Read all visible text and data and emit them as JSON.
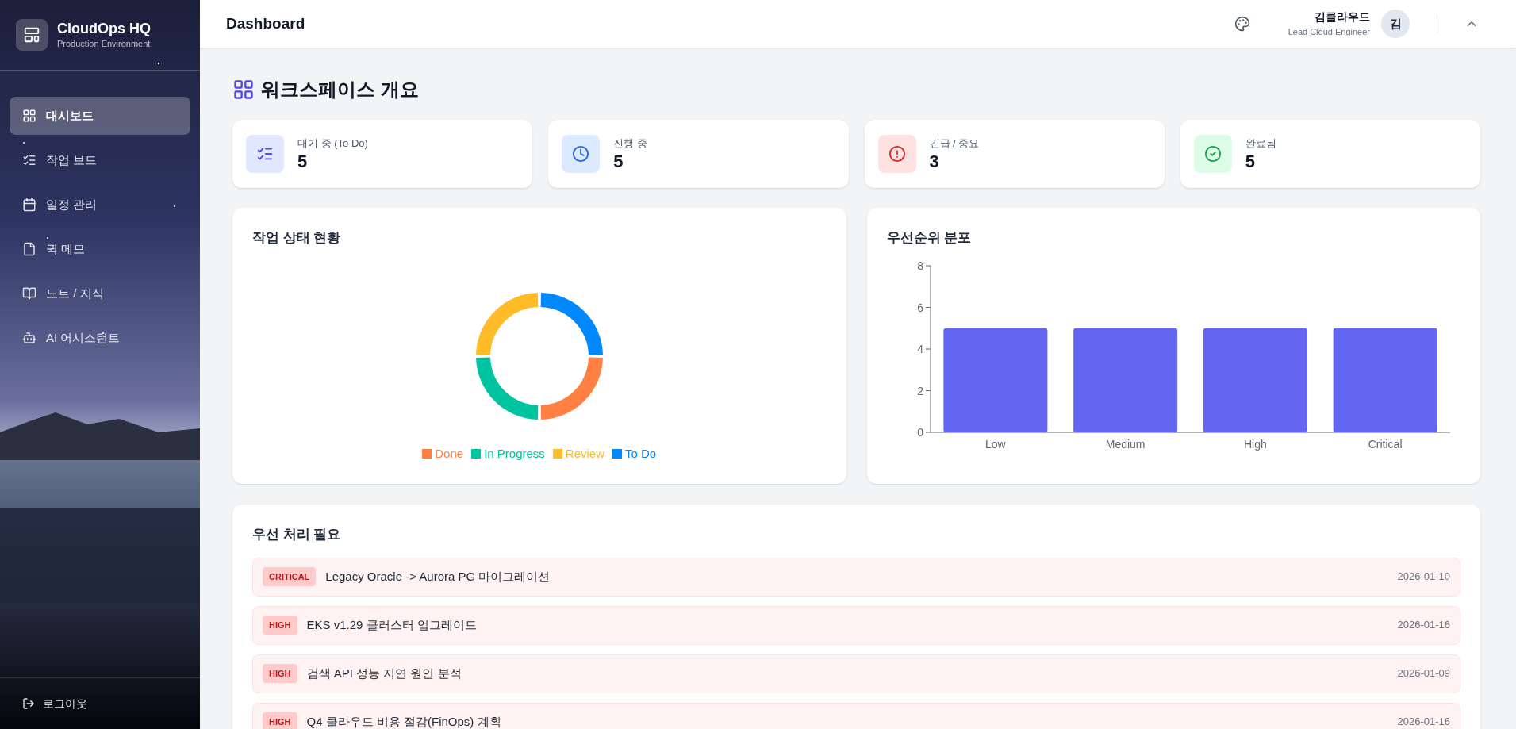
{
  "brand": {
    "name": "CloudOps HQ",
    "subtitle": "Production Environment"
  },
  "nav": [
    {
      "label": "대시보드",
      "selected": true
    },
    {
      "label": "작업 보드",
      "selected": false
    },
    {
      "label": "일정 관리",
      "selected": false
    },
    {
      "label": "퀵 메모",
      "selected": false
    },
    {
      "label": "노트 / 지식",
      "selected": false
    },
    {
      "label": "AI 어시스턴트",
      "selected": false
    }
  ],
  "logout": "로그아웃",
  "header": {
    "title": "Dashboard",
    "user_name": "김클라우드",
    "user_role": "Lead Cloud Engineer",
    "avatar": "김"
  },
  "page_title": "워크스페이스 개요",
  "stats": [
    {
      "label": "대기 중 (To Do)",
      "value": "5",
      "kind": "todo"
    },
    {
      "label": "진행 중",
      "value": "5",
      "kind": "progress"
    },
    {
      "label": "긴급 / 중요",
      "value": "3",
      "kind": "urgent"
    },
    {
      "label": "완료됨",
      "value": "5",
      "kind": "done"
    }
  ],
  "status_card": {
    "title": "작업 상태 현황",
    "chart_data": {
      "type": "donut",
      "categories": [
        "Done",
        "In Progress",
        "Review",
        "To Do"
      ],
      "values": [
        25,
        25,
        25,
        25
      ],
      "colors": [
        "#ff8042",
        "#00c49f",
        "#ffbb28",
        "#0088fe"
      ],
      "legend": "bottom"
    }
  },
  "priority_card": {
    "title": "우선순위 분포",
    "chart_data": {
      "type": "bar",
      "categories": [
        "Low",
        "Medium",
        "High",
        "Critical"
      ],
      "values": [
        5,
        5,
        5,
        5
      ],
      "color": "#6366f1",
      "ylim": [
        0,
        8
      ],
      "yticks": [
        0,
        2,
        4,
        6,
        8
      ]
    }
  },
  "urgent": {
    "title": "우선 처리 필요",
    "items": [
      {
        "badge": "CRITICAL",
        "title": "Legacy Oracle -> Aurora PG 마이그레이션",
        "date": "2026-01-10"
      },
      {
        "badge": "HIGH",
        "title": "EKS v1.29 클러스터 업그레이드",
        "date": "2026-01-16"
      },
      {
        "badge": "HIGH",
        "title": "검색 API 성능 지연 원인 분석",
        "date": "2026-01-09"
      },
      {
        "badge": "HIGH",
        "title": "Q4 클라우드 비용 절감(FinOps) 계획",
        "date": "2026-01-16"
      }
    ]
  }
}
